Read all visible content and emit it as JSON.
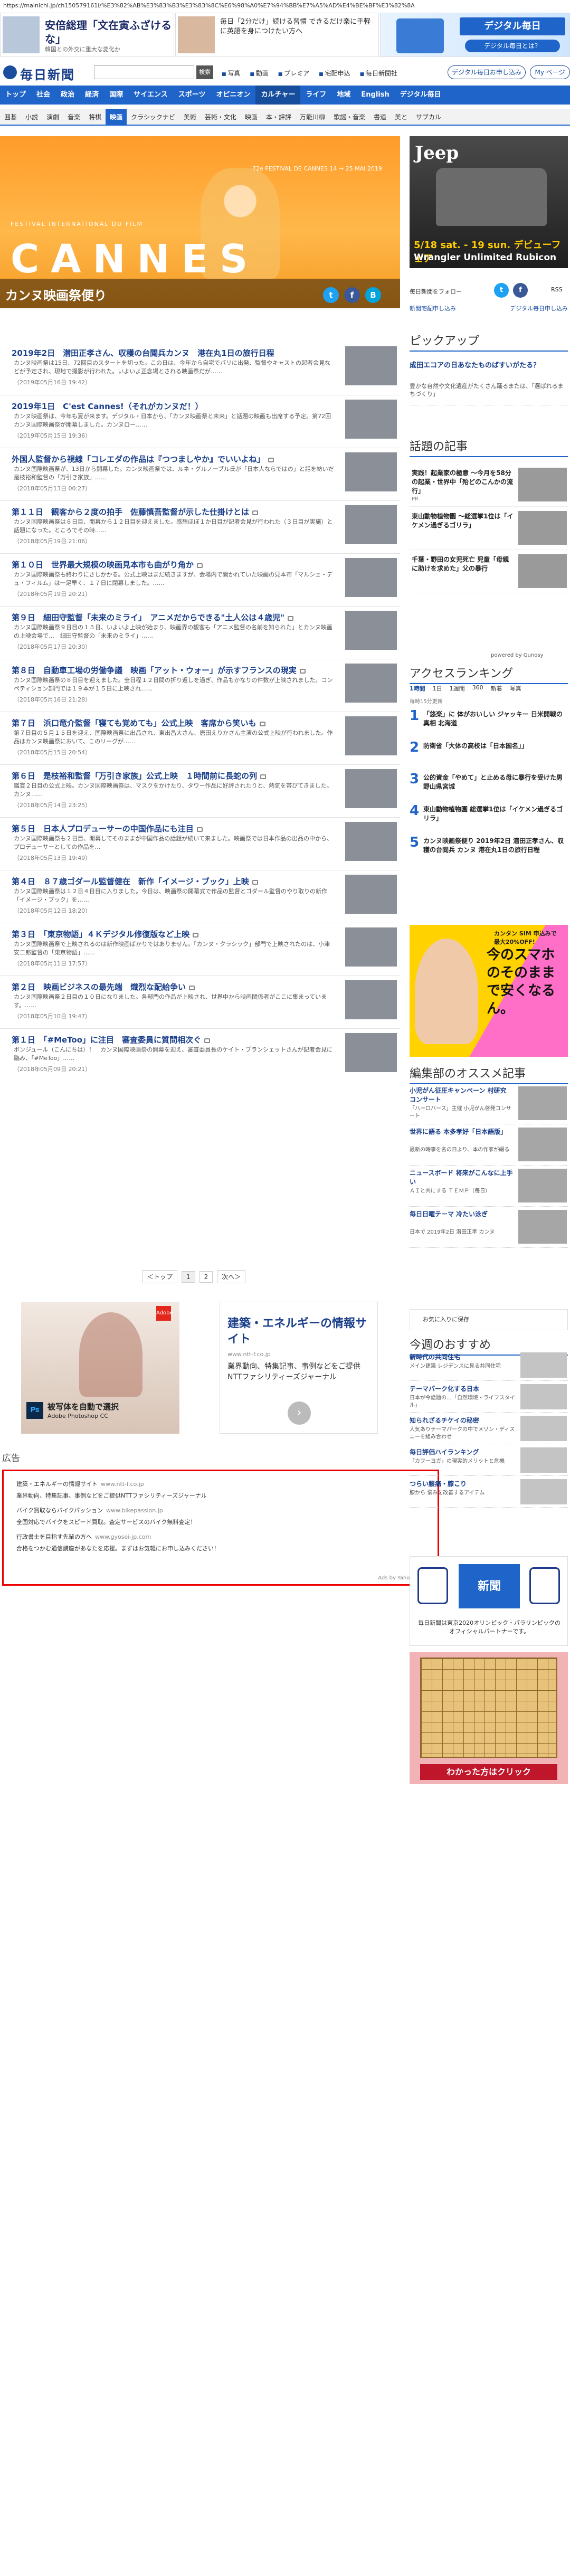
{
  "url": "https://mainichi.jp/ch150579161i/%E3%82%AB%E3%83%B3%E3%83%8C%E6%98%A0%E7%94%BB%E7%A5%AD%E4%BE%BF%E3%82%8A",
  "top_ads": {
    "ad1_title": "安倍総理「文在寅ふざけるな」",
    "ad1_sub": "韓国との外交に重大な変化か",
    "ad2_text": "毎日「2分だけ」続ける習慣 できるだけ楽に手軽に英語を身につけたい方へ",
    "ad3_brand": "デジタル毎日",
    "ad3_cta": "デジタル毎日とは？"
  },
  "header": {
    "logo": "毎日新聞",
    "search_button": "検索",
    "links": [
      "写真",
      "動画",
      "プレミア",
      "宅配申込",
      "毎日新聞社"
    ],
    "login": "デジタル毎日お申し込み",
    "my": "My ページ"
  },
  "nav_main": [
    "トップ",
    "社会",
    "政治",
    "経済",
    "国際",
    "サイエンス",
    "スポーツ",
    "オピニオン",
    "カルチャー",
    "ライフ",
    "地域",
    "English",
    "デジタル毎日"
  ],
  "nav_main_active": "カルチャー",
  "nav_sub": [
    "囲碁",
    "小説",
    "演劇",
    "音楽",
    "将棋",
    "映画",
    "クラシックナビ",
    "美術",
    "芸術・文化",
    "映画",
    "本・評評",
    "万能川柳",
    "歌謡・音楽",
    "書道",
    "美と",
    "サブカル"
  ],
  "nav_sub_active": "映画",
  "hero": {
    "festival": "FESTIVAL INTERNATIONAL DU FILM",
    "badge": "72e FESTIVAL DE CANNES 14 → 25 MAI 2019",
    "word": "CANNES",
    "title": "カンヌ映画祭便り"
  },
  "jeep": {
    "logo": "Jeep",
    "date": "5/18 sat. - 19 sun. デビューフェア",
    "model": "Wrangler Unlimited Rubicon"
  },
  "right_social": {
    "label": "毎日新聞をフォロー",
    "rss": "RSS",
    "btn1": "新聞宅配申し込み",
    "btn2": "デジタル毎日申し込み"
  },
  "pickup_heading": "ピックアップ",
  "pickup": [
    {
      "title": "成田エコアの日あなたものばすいがたる？",
      "desc": "豊かな自然や文化遺産がたくさん踊るまたは、「選ばれるまちづくり」"
    },
    {
      "title": "",
      "desc": ""
    }
  ],
  "wadai_heading": "話題の記事",
  "wadai": [
    {
      "title": "実践！起業家の極意 ～今月を58分の起業・世界中「殆どのこんかの流行」",
      "src": "PR"
    },
    {
      "title": "東山動物植物園 ～総選挙1位は「イケメン過ぎるゴリラ」",
      "src": ""
    },
    {
      "title": "千葉・野田の女児死亡 児童「母親に助けを求めた」父の暴行",
      "src": ""
    }
  ],
  "powered": "powered by Gunosy",
  "ranking_heading": "アクセスランキング",
  "ranking_tabs": [
    "1時間",
    "1日",
    "1週間",
    "360",
    "新着",
    "写真"
  ],
  "ranking_time": "毎時15分更新",
  "ranking": [
    "「悠楽」に 体がおいしい ジャッキー 日米開戦の真相 北海道",
    "防衛省「大体の高校は「日本国名」」",
    "公的資金「やめて」と止める母に暴行を受けた男 野山県宮城",
    "東山動物植物園 総選挙1位は「イケメン過ぎるゴリラ」",
    "カンヌ映画祭便り 2019年2日 潜田正孝さん、収穫の台閲兵 カンヌ 港在丸1日の旅行日程"
  ],
  "ad_woman": {
    "top": "カンタン SIM 申込みで 最大20%OFF!",
    "big": "今のスマホのそのままで安くなるん。"
  },
  "recommend_heading": "編集部のオススメ記事",
  "recommend": [
    {
      "title": "小児がん征圧キャンペーン 村研究 コンサート",
      "desc": "「ハーロバース」主催 小児がん啓発コンサート"
    },
    {
      "title": "世界に語る 本多孝好「日本語版」",
      "desc": "最新の時事を名の日より、本の作家が綴る"
    },
    {
      "title": "ニュースボード 将来がこんなに上手い",
      "desc": "ＡＩと共にする ＴＥＭＰ（毎日）"
    },
    {
      "title": "毎日日曜テーマ 冷たい泳ぎ",
      "desc": "日本で 2019年2日 潜田正孝 カンヌ"
    }
  ],
  "bookmark": "お気に入りに保存",
  "kyou_heading": "今週のおすすめ",
  "kyou": [
    {
      "title": "新時代の共同住宅",
      "desc": "メイン建築 レジデンスに見る共同住宅"
    },
    {
      "title": "テーマパーク化する日本",
      "desc": "日本が今話題の…「自然環境・ライフスタイル」"
    },
    {
      "title": "知られざるチケイの秘密",
      "desc": "人気ありテーマパークの中でメゾン・ディスニーを組み合わせ"
    },
    {
      "title": "毎日評価ハイランキング",
      "desc": "「カフーヨガ」の現実的メリットと危機"
    },
    {
      "title": "つらい腰痛・膝こり",
      "desc": "膝から 悩みを改善するアイテム"
    }
  ],
  "olympic": {
    "mid": "新聞",
    "caption": "毎日新聞は東京2020オリンピック・パラリンピックのオフィシャルパートナーです。"
  },
  "igo_cta": "わかった方はクリック",
  "articles": [
    {
      "title": "2019年2日　潜田正孝さん、収穫の台閲兵カンヌ　港在丸1日の旅行日程",
      "sum": "カンヌ映画祭は15日、72回目のスタートを切った。この日は、今年から自宅でパリに出発、監督やキャストの起者会見などが予定され、現地で撮影が行われた。いよいよ正念場とされる映画祭だが……",
      "date": "（2019年05月16日 19:42）",
      "lock": false
    },
    {
      "title": "2019年1日　C'est Cannes!（それがカンヌだ！）",
      "sum": "カンヌ映画祭は、今年も夏が来ます。デジタル・日本から、「カンヌ映画祭と未来」と話題の映画も出席する予定。第72回カンヌ国際映画祭が開幕しました。カンヌロー……",
      "date": "（2019年05月15日 19:36）",
      "lock": false
    },
    {
      "title": "外国人監督から視線「コレエダの作品は『つつましやか』でいいよね」",
      "sum": "カンヌ国際映画祭が、13日から開幕した。カンヌ映画祭では、ルネ・グルノーブル氏が「日本人ならではの」と話を紡いだ是枝裕和監督の「万引き家族」……",
      "date": "（2018年05月13日 00:27）",
      "lock": true
    },
    {
      "title": "第１１日　観客から２度の拍手　佐藤慎吾監督が示した仕掛けとは",
      "sum": "カンヌ国際映画祭は８日目、開幕から１２日目を迎えました。感想ほぼ１か日目が記者会見が行われた（３日目が実施）と話題になった。ところでその時……",
      "date": "（2018年05月19日 21:06）",
      "lock": true
    },
    {
      "title": "第１０日　世界最大規模の映画見本市も曲がり角か",
      "sum": "カンヌ国際映画祭も終わりにさしかかる。公式上映はまだ続きますが、会場内で開かれていた映画の見本市「マルシェ・デュ・フィルム」は一足早く、１７日に閉幕しました。……",
      "date": "（2018年05月19日 20:21）",
      "lock": true
    },
    {
      "title": "第９日　細田守監督「未来のミライ」　アニメだからできる\"土人公は４歳児\"",
      "sum": "カンヌ国際映画祭９日目の１５日、いよいよ上映が始まり、映画界の観客も「アニメ監督の名前を知られた」とカンヌ映画の上映会場で…　細田守監督の「未来のミライ」……",
      "date": "（2018年05月17日 20:30）",
      "lock": true
    },
    {
      "title": "第８日　自動車工場の労働争議　映画「アット・ウォー」が示すフランスの現実",
      "sum": "カンヌ国際映画祭の８日目を迎えました。全日程１２日間の折り返しを過ぎ、作品もかなりの件数が上映されました。コンペティション部門では１９本が１５日に上映され……",
      "date": "（2018年05月16日 21:28）",
      "lock": true
    },
    {
      "title": "第７日　浜口竜介監督「寝ても覚めても」公式上映　客席から笑いも",
      "sum": "第７日目の５月１５日を迎え、国際映画祭に出品され、東出昌大さん、唐田えりかさん主演の公式上映が行われました。作品はカンヌ映画祭において、このリーグが……",
      "date": "（2018年05月15日 20:54）",
      "lock": true
    },
    {
      "title": "第６日　是枝裕和監督「万引き家族」公式上映　１時間前に長蛇の列",
      "sum": "鑑賞２日目の公式上映。カンヌ国際映画祭は、マスクをかけたり、タワー作品に好評されたりと、熱気を帯びてきました。カンヌ……",
      "date": "（2018年05月14日 23:25）",
      "lock": true
    },
    {
      "title": "第５日　日本人プロデューサーの中国作品にも注目",
      "sum": "カンヌ国際映画祭も２日目、開幕してそのままが中国作品の話題が続いて来ました。映画祭では日本作品の出品の中から、プロデューサーとしての作品を…",
      "date": "（2018年05月13日 19:49）",
      "lock": true
    },
    {
      "title": "第４日　８７歳ゴダール監督健在　新作「イメージ・ブック」上映",
      "sum": "カンヌ国際映画祭は１２日４日目に入りました。今日は、映画祭の開幕式で作品の監督とゴダール監督のやり取りの新作「イメージ・ブック」を……",
      "date": "（2018年05月12日 18:20）",
      "lock": true
    },
    {
      "title": "第３日　「東京物語」４Ｋデジタル修復版など上映",
      "sum": "カンヌ国際映画祭で上映されるのは新作映画ばかりではありません。「カンヌ・クラシック」部門で上映されたのは、小津安二郎監督の「東京物語」……",
      "date": "（2018年05月11日 17:57）",
      "lock": true
    },
    {
      "title": "第２日　映画ビジネスの最先端　熾烈な配給争い",
      "sum": "カンヌ国際映画祭２日目の１０日になりました。各部門の作品が上映され、世界中から映画関係者がここに集まっています。……",
      "date": "（2018年05月10日 19:47）",
      "lock": true
    },
    {
      "title": "第１日　「#MeToo」に注目　審査委員に質問相次ぐ",
      "sum": "ボンジュール（こんにちは）！　カンヌ国際映画祭の開幕を迎え、審査委員長のケイト・ブランシェットさんが記者会見に臨み、「#MeToo」……",
      "date": "（2018年05月09日 20:21）",
      "lock": true
    }
  ],
  "pager": [
    "＜トップ",
    "1",
    "2",
    "次へ＞"
  ],
  "ad_adobe": {
    "logo": "Adobe",
    "ps": "Ps",
    "copy": "被写体を自動で選択",
    "copy2": "Adobe Photoshop CC"
  },
  "ad_ntt": {
    "title": "建築・エネルギーの情報サイト",
    "url": "www.ntt-f.co.jp",
    "body": "業界動向、特集記事、事例などをご提供NTTファシリティーズジャーナル"
  },
  "kokoku": "広告",
  "ad_box": [
    {
      "text": "建築・エネルギーの情報サイト",
      "url": "www.ntt-f.co.jp"
    },
    {
      "text": "業界動向、特集記事、事例などをご提供NTTファシリティーズジャーナル",
      "url": ""
    },
    {
      "text": "バイク買取ならバイクパッション",
      "url": "www.bikepassion.jp"
    },
    {
      "text": "全国対応でバイクをスピード買取。査定サービスのバイク無料査定！",
      "url": ""
    },
    {
      "text": "行政書士を目指す先輩の方へ",
      "url": "www.gyosei-jp.com"
    },
    {
      "text": "合格をつかむ通信講座があなたを応援。まずはお気軽にお申し込みください！",
      "url": ""
    }
  ],
  "ad_credit": "Ads by Yahoo! JAPAN"
}
